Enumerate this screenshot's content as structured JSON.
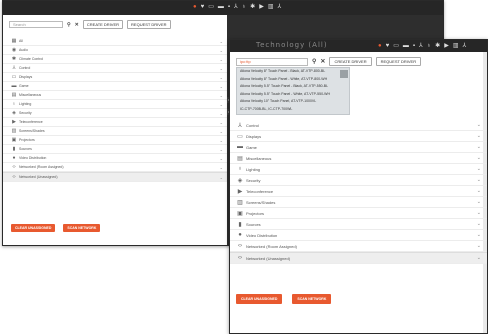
{
  "back_window": {
    "brand": "oasis",
    "search": {
      "placeholder": "Search"
    },
    "create_driver": "CREATE DRIVER",
    "request_driver": "REQUEST DRIVER",
    "items": [
      {
        "label": "All",
        "icon": "grid-icon",
        "glyph": "▦"
      },
      {
        "label": "Audio",
        "icon": "audio-icon",
        "glyph": "◉"
      },
      {
        "label": "Climate Control",
        "icon": "snowflake-icon",
        "glyph": "✱"
      },
      {
        "label": "Control",
        "icon": "control-icon",
        "glyph": "⅄"
      },
      {
        "label": "Displays",
        "icon": "monitor-icon",
        "glyph": "▭"
      },
      {
        "label": "Game",
        "icon": "gamepad-icon",
        "glyph": "▬"
      },
      {
        "label": "Miscellaneous",
        "icon": "misc-icon",
        "glyph": "▤"
      },
      {
        "label": "Lighting",
        "icon": "bulb-icon",
        "glyph": "♁"
      },
      {
        "label": "Security",
        "icon": "shield-icon",
        "glyph": "◈"
      },
      {
        "label": "Teleconference",
        "icon": "camera-icon",
        "glyph": "▶"
      },
      {
        "label": "Screens/Shades",
        "icon": "shades-icon",
        "glyph": "▥"
      },
      {
        "label": "Projectors",
        "icon": "projector-icon",
        "glyph": "▣"
      },
      {
        "label": "Sources",
        "icon": "source-icon",
        "glyph": "▮"
      },
      {
        "label": "Video Distribution",
        "icon": "distribution-icon",
        "glyph": "●"
      },
      {
        "label": "Networked (Room Assigned)",
        "icon": "network-icon",
        "glyph": "‹›"
      },
      {
        "label": "Networked (Unassigned)",
        "icon": "network-icon",
        "glyph": "‹›"
      }
    ],
    "clear_unassigned": "CLEAR UNASSIGNED",
    "scan_network": "SCAN NETWORK"
  },
  "front_window": {
    "brand": "Technology (All)",
    "search": {
      "value": "ipc:ttp"
    },
    "create_driver": "CREATE DRIVER",
    "request_driver": "REQUEST DRIVER",
    "dropdown": [
      "Atlona Velocity 8\" Touch Panel - Black, AT-VTP-800-BL",
      "Atlona Velocity 8\" Touch Panel - White, AT-VTP-800-WH",
      "Atlona Velocity 5.5\" Touch Panel - Black, AT-VTP-550-BL",
      "Atlona Velocity 5.5\" Touch Panel - White, AT-VTP-550-WH",
      "Atlona Velocity 10\" Touch Panel, AT-VTP-1000VL",
      "IC-CTP-700B-BL, IC-CTP-700WL"
    ],
    "items": [
      {
        "label": "Control",
        "icon": "control-icon",
        "glyph": "⅄"
      },
      {
        "label": "Displays",
        "icon": "monitor-icon",
        "glyph": "▭"
      },
      {
        "label": "Game",
        "icon": "gamepad-icon",
        "glyph": "▬"
      },
      {
        "label": "Miscellaneous",
        "icon": "misc-icon",
        "glyph": "▤"
      },
      {
        "label": "Lighting",
        "icon": "bulb-icon",
        "glyph": "♁"
      },
      {
        "label": "Security",
        "icon": "shield-icon",
        "glyph": "◈"
      },
      {
        "label": "Teleconference",
        "icon": "camera-icon",
        "glyph": "▶"
      },
      {
        "label": "Screens/Shades",
        "icon": "shades-icon",
        "glyph": "▥"
      },
      {
        "label": "Projectors",
        "icon": "projector-icon",
        "glyph": "▣"
      },
      {
        "label": "Sources",
        "icon": "source-icon",
        "glyph": "▮"
      },
      {
        "label": "Video Distribution",
        "icon": "distribution-icon",
        "glyph": "●"
      },
      {
        "label": "Networked (Room Assigned)",
        "icon": "network-icon",
        "glyph": "‹›"
      },
      {
        "label": "Networked (Unassigned)",
        "icon": "network-icon",
        "glyph": "‹›"
      }
    ],
    "clear_unassigned": "CLEAR UNASSIGNED",
    "scan_network": "SCAN NETWORK"
  },
  "colors": {
    "accent": "#e8592f",
    "topbar": "#262626",
    "dropdown_bg": "#dde1e4"
  }
}
